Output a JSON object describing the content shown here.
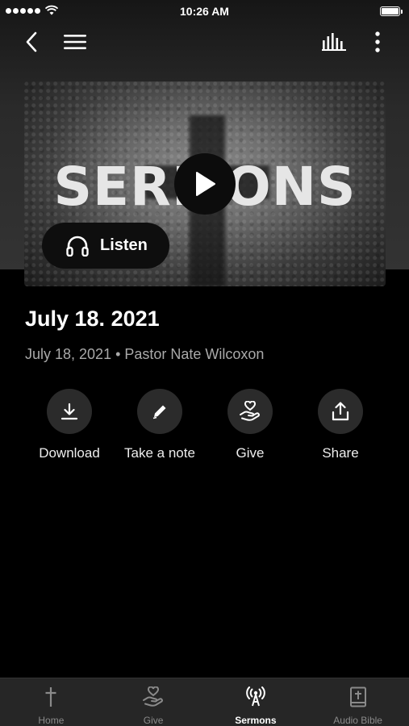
{
  "status_bar": {
    "time": "10:26 AM"
  },
  "nav": {
    "back_icon": "chevron-left-icon",
    "menu_icon": "hamburger-icon",
    "audio_icon": "audio-bars-icon",
    "more_icon": "more-vertical-icon"
  },
  "hero": {
    "artwork_text": "SERMONS",
    "listen_label": "Listen"
  },
  "sermon": {
    "title": "July 18. 2021",
    "meta": "July 18, 2021 • Pastor Nate Wilcoxon"
  },
  "actions": [
    {
      "label": "Download",
      "icon": "download-icon"
    },
    {
      "label": "Take a note",
      "icon": "pencil-icon"
    },
    {
      "label": "Give",
      "icon": "give-hand-heart-icon"
    },
    {
      "label": "Share",
      "icon": "share-icon"
    }
  ],
  "tabs": [
    {
      "label": "Home",
      "icon": "cross-icon",
      "active": false
    },
    {
      "label": "Give",
      "icon": "give-hand-heart-icon",
      "active": false
    },
    {
      "label": "Sermons",
      "icon": "broadcast-icon",
      "active": true
    },
    {
      "label": "Audio Bible",
      "icon": "bible-icon",
      "active": false
    }
  ],
  "colors": {
    "background": "#000000",
    "tab_bar": "#262626",
    "action_circle": "#2b2b2b",
    "meta_text": "#a9a9a9",
    "inactive_tab": "#8a8a8a"
  }
}
